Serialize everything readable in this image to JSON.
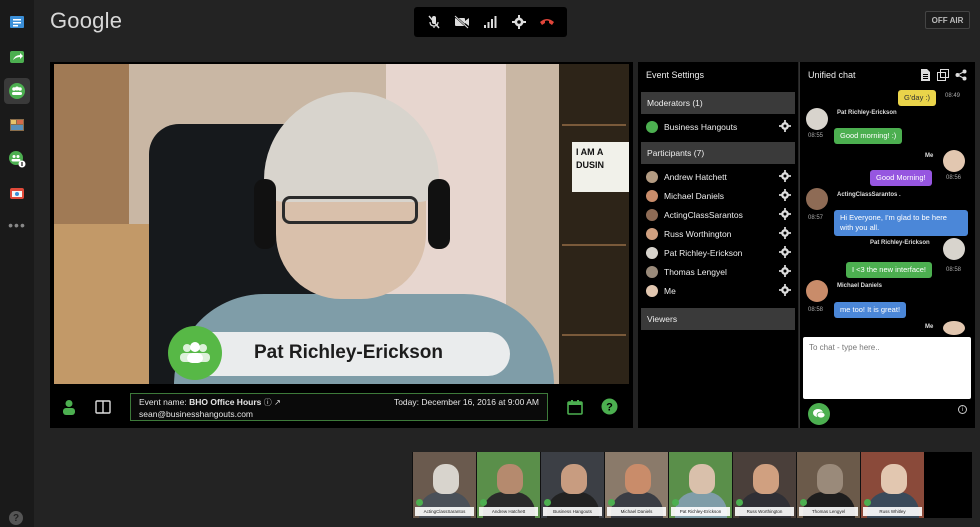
{
  "app": {
    "logo": "Google",
    "off_air_label": "OFF AIR"
  },
  "left_rail": {
    "items": [
      "chat-icon",
      "share-icon",
      "hangouts-icon",
      "gallery-icon",
      "people-icon",
      "cameraman-icon",
      "more-icon",
      "help-icon"
    ],
    "help_label": "?"
  },
  "top_controls": [
    "mic-muted-icon",
    "camera-off-icon",
    "bandwidth-icon",
    "settings-icon",
    "hang-up-icon"
  ],
  "stage": {
    "speaker_name": "Pat Richley-Erickson",
    "sign_text": "I AM A DUSIN",
    "event": {
      "name_label": "Event name:",
      "name_value": "BHO Office Hours",
      "email": "sean@businesshangouts.com",
      "date": "Today: December 16, 2016 at 9:00 AM"
    }
  },
  "event_settings": {
    "title": "Event Settings",
    "moderators_header": "Moderators (1)",
    "moderators": [
      "Business Hangouts"
    ],
    "participants_header": "Participants (7)",
    "participants": [
      "Andrew Hatchett",
      "Michael Daniels",
      "ActingClassSarantos",
      "Russ Worthington",
      "Pat Richley-Erickson",
      "Thomas Lengyel",
      "Me"
    ],
    "viewers_header": "Viewers"
  },
  "chat": {
    "title": "Unified chat",
    "messages": [
      {
        "author": "",
        "text": "G'day :)",
        "time": "08:49",
        "side": "right",
        "color": "yellow"
      },
      {
        "author": "Pat Richley-Erickson",
        "text": "Good morning! :)",
        "time": "08:55",
        "side": "left",
        "color": "green"
      },
      {
        "author": "Me",
        "text": "Good Morning!",
        "time": "08:56",
        "side": "right",
        "color": "purple"
      },
      {
        "author": "ActingClassSarantos .",
        "text": "Hi Everyone, I'm glad to be here with you all.",
        "time": "08:57",
        "side": "left",
        "color": "blue"
      },
      {
        "author": "Pat Richley-Erickson",
        "text": "I <3 the new interface!",
        "time": "08:58",
        "side": "right",
        "color": "green"
      },
      {
        "author": "Michael Daniels",
        "text": "me too! It is great!",
        "time": "08:58",
        "side": "left",
        "color": "blue"
      },
      {
        "author": "Me",
        "text": "",
        "time": "",
        "side": "right",
        "color": "none"
      }
    ],
    "input_placeholder": "To chat - type here..",
    "info_label": "i"
  },
  "filmstrip": {
    "tiles": [
      {
        "label": "ActingClassSarantos"
      },
      {
        "label": "Andrew Hatchett"
      },
      {
        "label": "Business Hangouts"
      },
      {
        "label": "Michael Daniels"
      },
      {
        "label": "Pat Richley-Erickson"
      },
      {
        "label": "Russ Worthington"
      },
      {
        "label": "Thomas Lengyel"
      },
      {
        "label": "Russ Whitley"
      }
    ]
  },
  "colors": {
    "accent_green": "#57b846",
    "background": "#232323",
    "panel": "#000000"
  }
}
